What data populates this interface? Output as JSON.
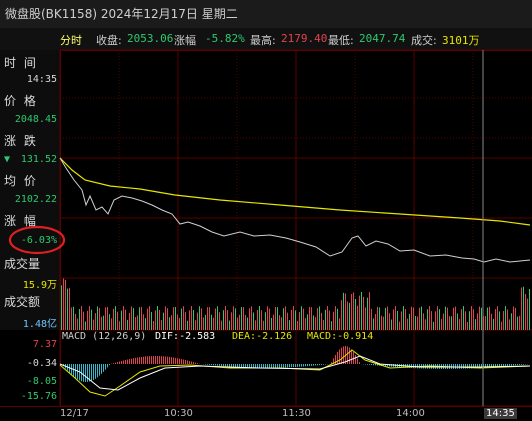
{
  "window": {
    "title": "微盘股(BK1158) 2024年12月17日 星期二"
  },
  "quote_bar": {
    "mode": "分时",
    "close_label": "收盘:",
    "close_value": "2053.06",
    "change_label": "涨幅",
    "change_value": "-5.82%",
    "high_label": "最高:",
    "high_value": "2179.40",
    "low_label": "最低:",
    "low_value": "2047.74",
    "volume_label": "成交:",
    "volume_value": "3101万"
  },
  "sidebar": {
    "time_label": "时 间",
    "time_value": "14:35",
    "price_label": "价 格",
    "price_value": "2048.45",
    "change_label": "涨 跌",
    "change_value": "131.52",
    "change_arrow": "▼",
    "avg_label": "均 价",
    "avg_value": "2102.22",
    "pct_label": "涨 幅",
    "pct_value": "-6.03%",
    "volume_label": "成交量",
    "volume_value": "15.9万",
    "amount_label": "成交额",
    "amount_value": "1.48亿"
  },
  "macd": {
    "header": "MACD (12,26,9)",
    "dif_label": "DIF:-2.583",
    "dea_label": "DEA:-2.126",
    "macd_label": "MACD:-0.914",
    "axis_ticks": [
      "7.37",
      "-0.34",
      "-8.05",
      "-15.76"
    ]
  },
  "time_axis": [
    "12/17",
    "10:30",
    "11:30",
    "14:00",
    "14:35"
  ],
  "colors": {
    "price_line": "#d0d0d0",
    "avg_line": "#e6e600",
    "down": "#2ec96f",
    "up": "#e0454d",
    "grid": "#5a0000",
    "annotation": "#e02020"
  }
}
